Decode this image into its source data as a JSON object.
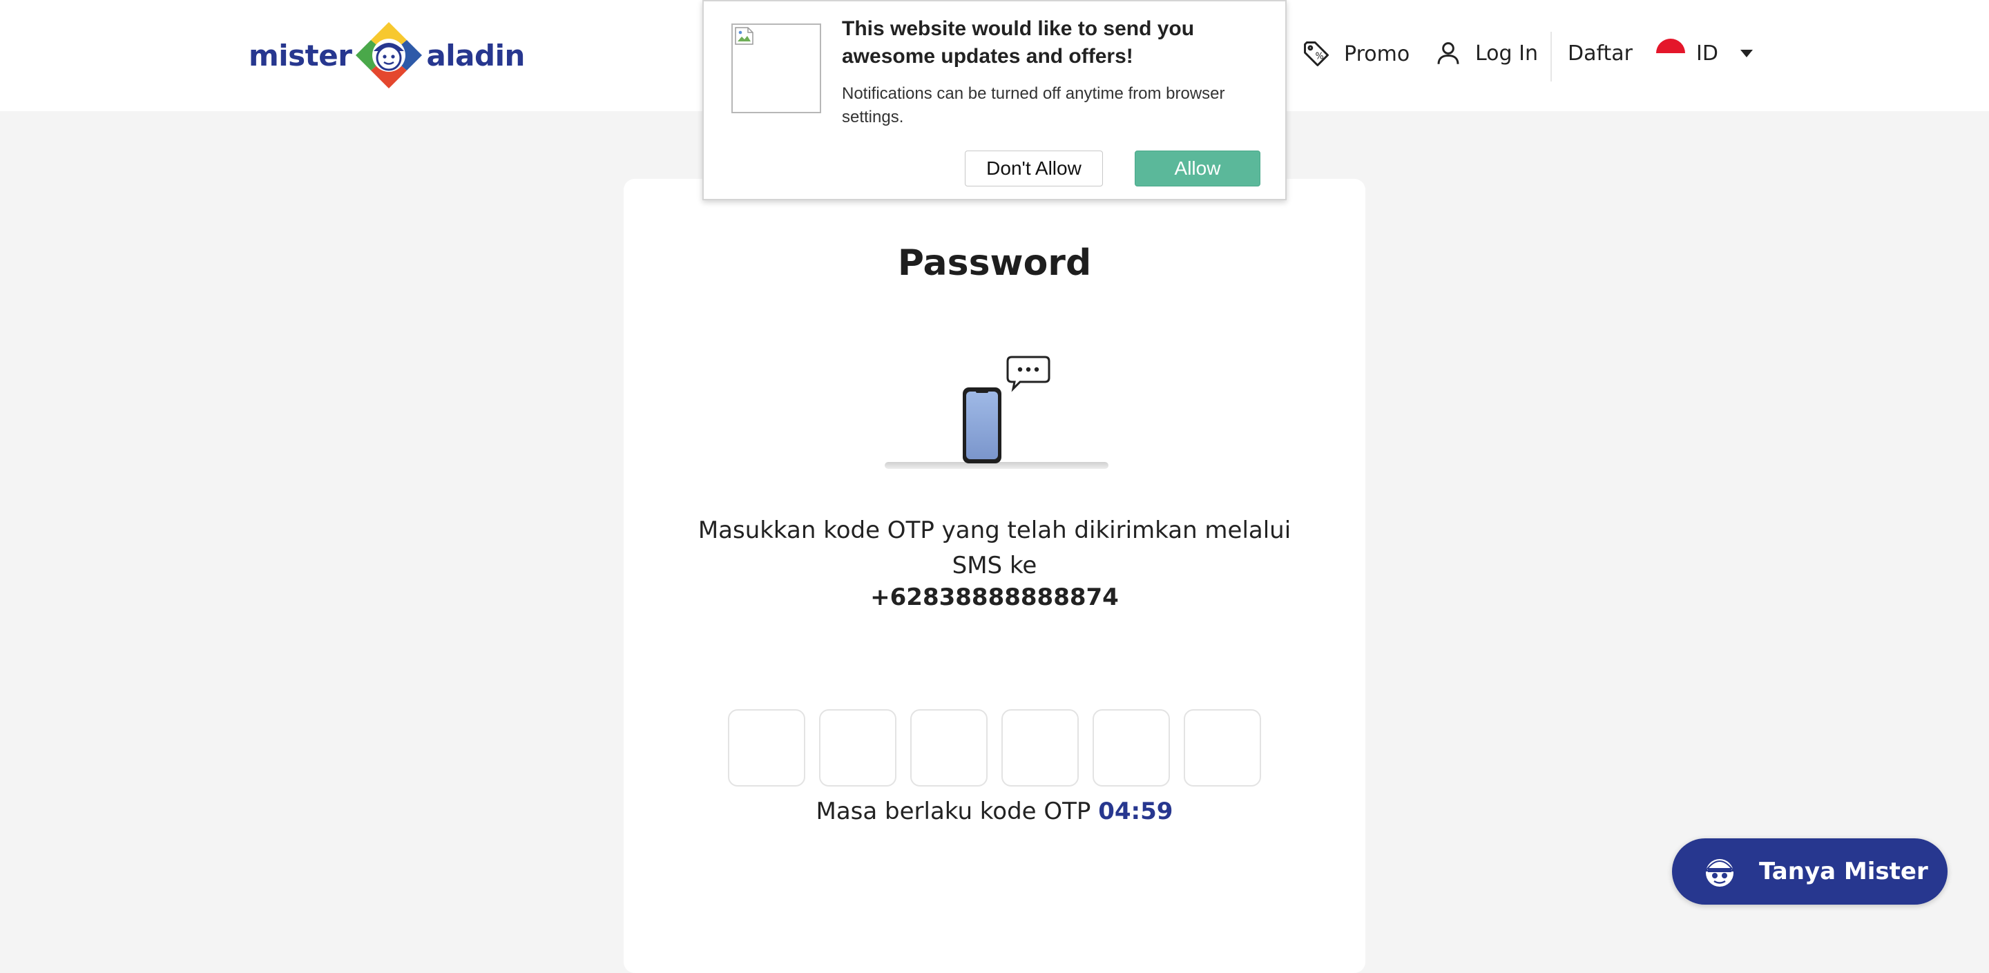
{
  "header": {
    "logo": {
      "left_word": "mister",
      "right_word": "aladin"
    },
    "nav": {
      "promo_label": "Promo",
      "login_label": "Log In",
      "register_label": "Daftar",
      "language_label": "ID"
    }
  },
  "notification_prompt": {
    "title": "This website would like to send you awesome updates and offers!",
    "body": "Notifications can be turned off anytime from browser settings.",
    "deny_label": "Don't Allow",
    "allow_label": "Allow"
  },
  "otp_card": {
    "title": "Password",
    "instruction": "Masukkan kode OTP yang telah dikirimkan melalui SMS ke",
    "phone_number": "+62838888888874",
    "otp_digits": [
      "",
      "",
      "",
      "",
      "",
      ""
    ],
    "timer_label": "Masa berlaku kode OTP",
    "timer_value": "04:59"
  },
  "chat_button": {
    "label": "Tanya Mister"
  },
  "colors": {
    "brand_blue": "#27378f",
    "allow_green": "#5bb89a",
    "page_background": "#f4f4f4",
    "flag_red": "#e4162a"
  },
  "icons": {
    "promo": "tag-percent-icon",
    "login": "user-icon",
    "language": "indonesia-flag-icon",
    "language_menu": "caret-down-icon",
    "chat": "mister-aladin-mascot-icon",
    "illustration": "phone-sms-illustration"
  }
}
